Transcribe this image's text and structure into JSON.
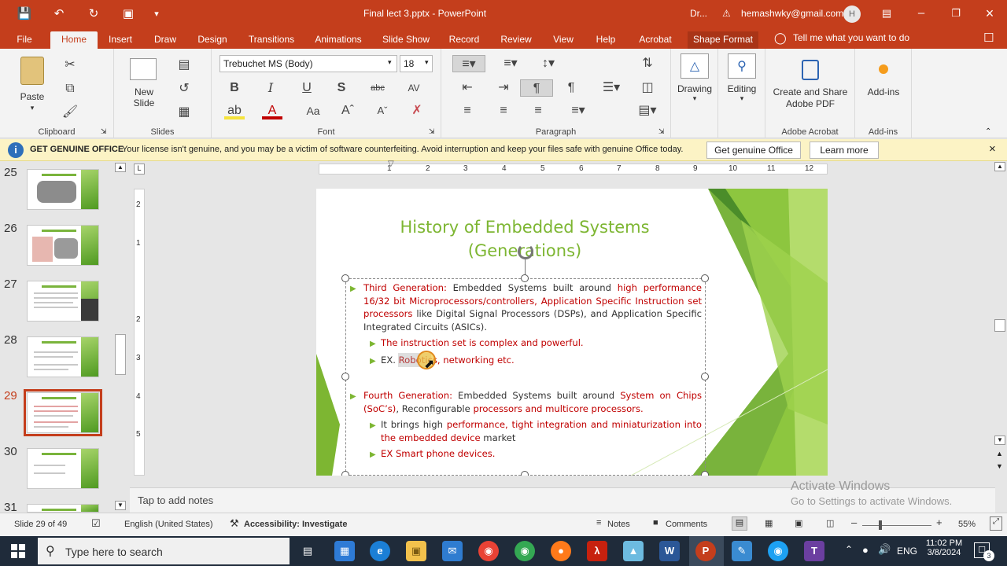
{
  "window": {
    "title": "Final lect 3.pptx  -  PowerPoint",
    "truncated_label": "Dr...",
    "account_email": "hemashwky@gmail.com",
    "avatar_initial": "H"
  },
  "tabs": [
    "File",
    "Home",
    "Insert",
    "Draw",
    "Design",
    "Transitions",
    "Animations",
    "Slide Show",
    "Record",
    "Review",
    "View",
    "Help",
    "Acrobat",
    "Shape Format"
  ],
  "tell_me": "Tell me what you want to do",
  "ribbon": {
    "clipboard": {
      "paste": "Paste",
      "label": "Clipboard"
    },
    "slides": {
      "new_slide": "New",
      "new_slide2": "Slide",
      "label": "Slides"
    },
    "font": {
      "family": "Trebuchet MS (Body)",
      "size": "18",
      "label": "Font",
      "buttons": [
        "B",
        "I",
        "U",
        "S",
        "abc",
        "AV"
      ]
    },
    "paragraph": {
      "label": "Paragraph"
    },
    "drawing": "Drawing",
    "editing": "Editing",
    "adobe": {
      "line1": "Create and Share",
      "line2": "Adobe PDF",
      "label": "Adobe Acrobat"
    },
    "addins": {
      "button": "Add-ins",
      "label": "Add-ins"
    }
  },
  "message_bar": {
    "title": "GET GENUINE OFFICE",
    "text": "Your license isn't genuine, and you may be a victim of software counterfeiting. Avoid interruption and keep your files safe with genuine Office today.",
    "button1": "Get genuine Office",
    "button2": "Learn more"
  },
  "thumbnails": [
    "25",
    "26",
    "27",
    "28",
    "29",
    "30",
    "31"
  ],
  "selected_slide": "29",
  "ruler_h": [
    "1",
    "1",
    "2",
    "3",
    "4",
    "5",
    "6",
    "7",
    "8",
    "9",
    "10",
    "11",
    "12"
  ],
  "ruler_v": [
    "2",
    "1",
    "1",
    "2",
    "3",
    "4",
    "5"
  ],
  "slide": {
    "title_line1": "History of Embedded Systems",
    "title_line2": "(Generations)",
    "p1_label": "Third Generation:",
    "p1_text1": " Embedded Systems built around ",
    "p1_red1": "high performance 16/32 bit Microprocessors/controllers, Application Specific Instruction set processors",
    "p1_text2": " like Digital Signal Processors (DSPs), and Application Specific Integrated Circuits (ASICs).",
    "b1": "The instruction set is complex and powerful.",
    "b2_prefix": "EX. ",
    "b2_red": "Robotics, networking etc.",
    "p2_label": "Fourth Generation:",
    "p2_text1": " Embedded Systems built around ",
    "p2_red1": "System on Chips (SoC’s)",
    "p2_text2": ", Reconfigurable ",
    "p2_red2": "processors and multicore processors.",
    "b3_prefix": "It brings high ",
    "b3_red": "performance, tight integration and miniaturization into the embedded device",
    "b3_suffix": " market",
    "b4": "EX Smart phone devices."
  },
  "notes_placeholder": "Tap to add notes",
  "watermark": {
    "line1": "Activate Windows",
    "line2": "Go to Settings to activate Windows."
  },
  "status": {
    "slide": "Slide 29 of 49",
    "language": "English (United States)",
    "accessibility": "Accessibility: Investigate",
    "notes": "Notes",
    "comments": "Comments",
    "zoom": "55%"
  },
  "taskbar": {
    "search": "Type here to search",
    "lang": "ENG",
    "time": "11:02 PM",
    "date": "3/8/2024",
    "notif": "3"
  },
  "colors": {
    "accent": "#c43e1c",
    "slide_green": "#7db632",
    "text_red": "#c00000"
  }
}
